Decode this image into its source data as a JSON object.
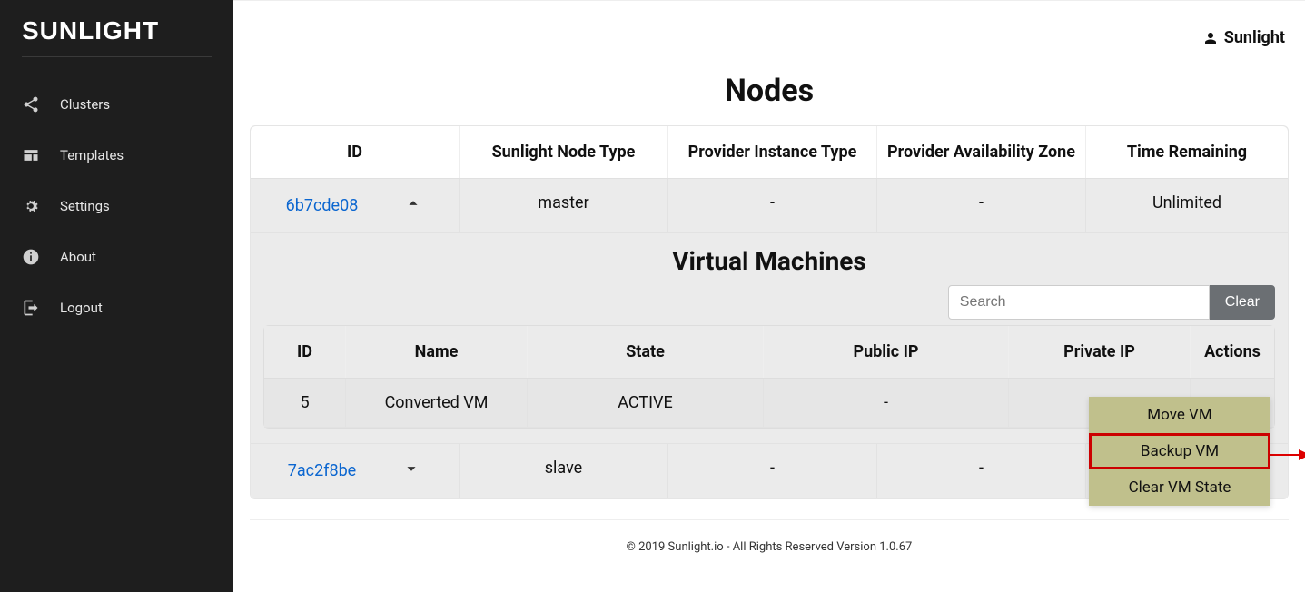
{
  "brand": "SUNLIGHT",
  "user": {
    "name": "Sunlight"
  },
  "sidebar": {
    "items": [
      {
        "label": "Clusters"
      },
      {
        "label": "Templates"
      },
      {
        "label": "Settings"
      },
      {
        "label": "About"
      },
      {
        "label": "Logout"
      }
    ]
  },
  "page": {
    "title": "Nodes"
  },
  "nodes_table": {
    "columns": [
      "ID",
      "Sunlight Node Type",
      "Provider Instance Type",
      "Provider Availability Zone",
      "Time Remaining"
    ],
    "rows": [
      {
        "id": "6b7cde08",
        "expanded": true,
        "node_type": "master",
        "instance_type": "-",
        "zone": "-",
        "time_remaining": "Unlimited"
      },
      {
        "id": "7ac2f8be",
        "expanded": false,
        "node_type": "slave",
        "instance_type": "-",
        "zone": "-",
        "time_remaining": ""
      }
    ]
  },
  "vm_section": {
    "title": "Virtual Machines",
    "search_placeholder": "Search",
    "clear_label": "Clear",
    "columns": [
      "ID",
      "Name",
      "State",
      "Public IP",
      "Private IP",
      "Actions"
    ],
    "rows": [
      {
        "id": "5",
        "name": "Converted VM",
        "state": "ACTIVE",
        "public_ip": "-",
        "private_ip": "-"
      }
    ]
  },
  "actions_menu": {
    "items": [
      {
        "label": "Move VM"
      },
      {
        "label": "Backup VM"
      },
      {
        "label": "Clear VM State"
      }
    ],
    "highlighted_index": 1
  },
  "footer": "© 2019 Sunlight.io - All Rights Reserved Version 1.0.67"
}
